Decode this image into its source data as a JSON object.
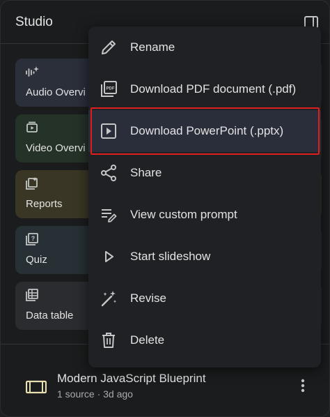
{
  "panel": {
    "title": "Studio"
  },
  "cards": [
    {
      "label": "Audio Overvi",
      "icon": "audio-sparkle-icon"
    },
    {
      "label": "Video Overvi",
      "icon": "video-icon"
    },
    {
      "label": "Reports",
      "icon": "report-add-icon"
    },
    {
      "label": "Quiz",
      "icon": "quiz-icon"
    },
    {
      "label": "Data table",
      "icon": "table-icon"
    }
  ],
  "menu": {
    "items": [
      {
        "label": "Rename",
        "icon": "pencil-icon"
      },
      {
        "label": "Download PDF document (.pdf)",
        "icon": "pdf-icon"
      },
      {
        "label": "Download PowerPoint (.pptx)",
        "icon": "slides-icon",
        "highlighted": true
      },
      {
        "label": "Share",
        "icon": "share-icon"
      },
      {
        "label": "View custom prompt",
        "icon": "prompt-icon"
      },
      {
        "label": "Start slideshow",
        "icon": "play-icon"
      },
      {
        "label": "Revise",
        "icon": "magic-wand-icon"
      },
      {
        "label": "Delete",
        "icon": "trash-icon"
      }
    ]
  },
  "note": {
    "title": "Modern JavaScript Blueprint",
    "subtitle": "1 source · 3d ago",
    "icon": "slides-deck-icon"
  },
  "colors": {
    "background": "#1b1c1d",
    "menu_bg": "#202124",
    "highlight_border": "#e01e1e",
    "highlight_bg": "#2a2d3a"
  }
}
